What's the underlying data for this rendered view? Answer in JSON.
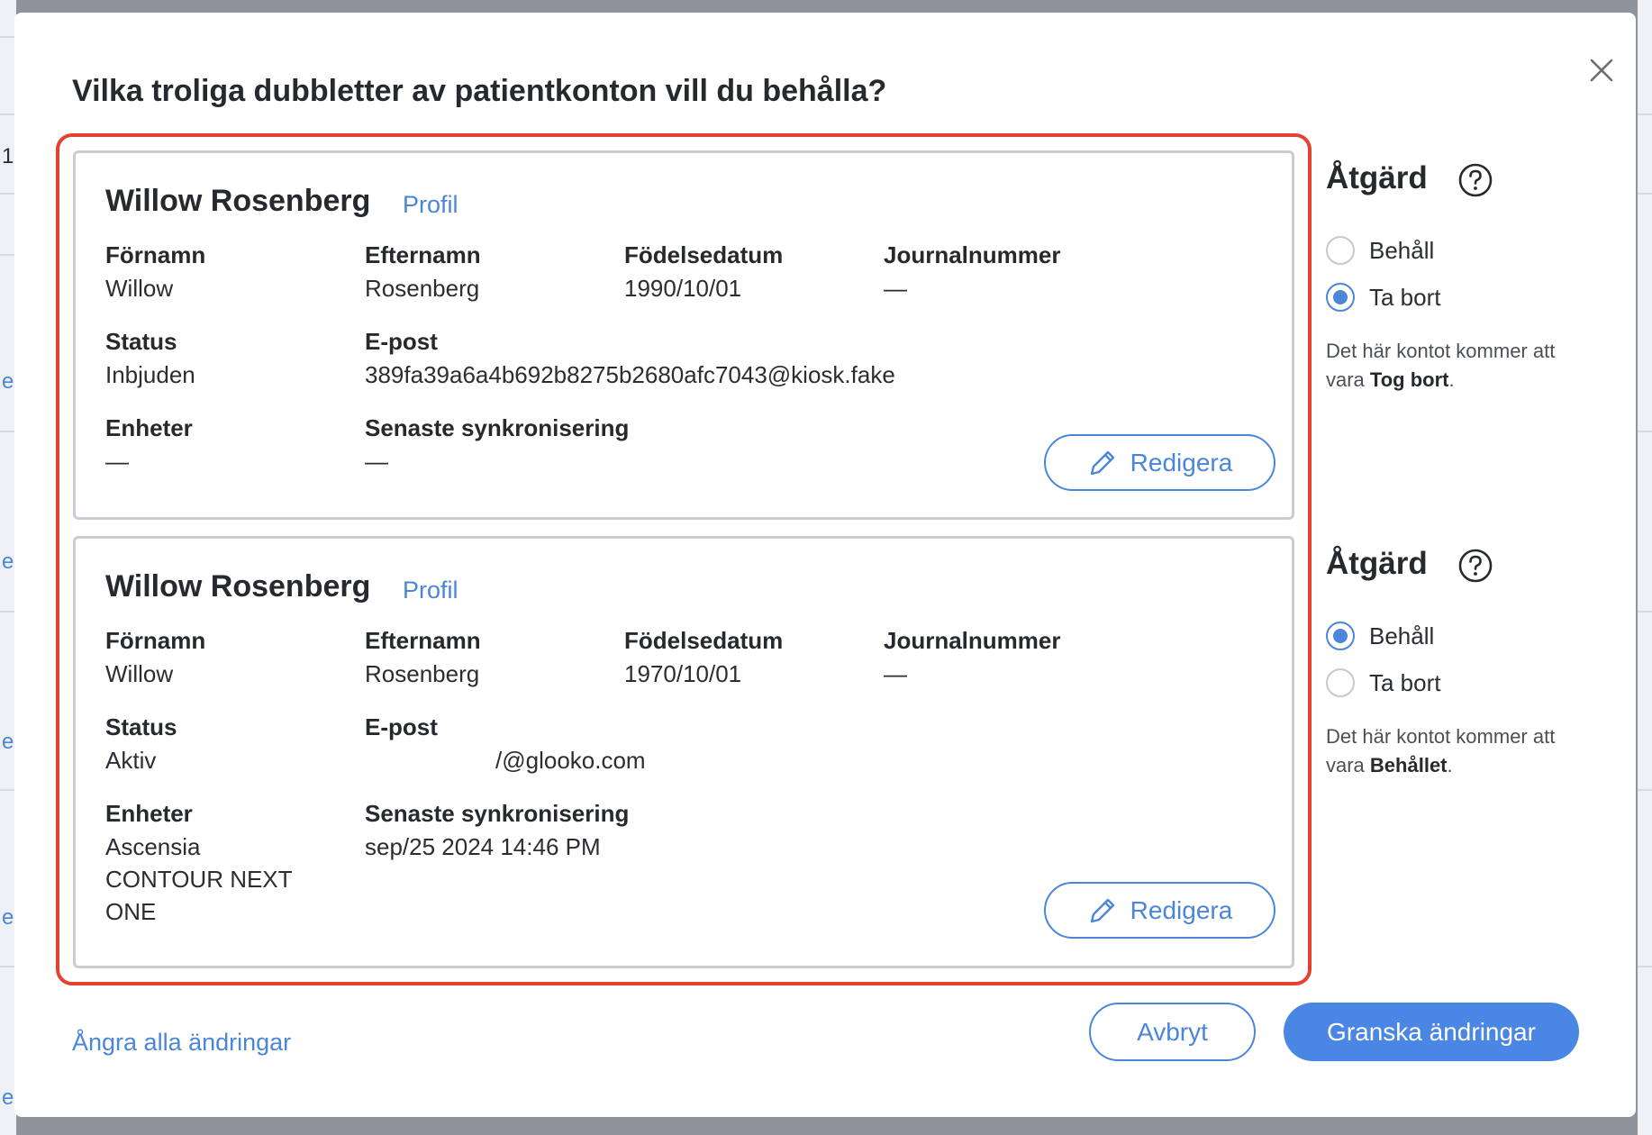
{
  "background": {
    "left_fragments": [
      "1",
      "e",
      "e",
      "e",
      "e",
      "e"
    ]
  },
  "modal": {
    "title": "Vilka troliga dubbletter av patientkonton vill du behålla?",
    "close_icon": "close-icon"
  },
  "accounts": [
    {
      "name": "Willow Rosenberg",
      "profile_link": "Profil",
      "labels": {
        "first_name": "Förnamn",
        "last_name": "Efternamn",
        "birthdate": "Födelsedatum",
        "record_number": "Journalnummer",
        "status": "Status",
        "email": "E-post",
        "devices": "Enheter",
        "last_sync": "Senaste synkronisering"
      },
      "values": {
        "first_name": "Willow",
        "last_name": "Rosenberg",
        "birthdate": "1990/10/01",
        "record_number": "—",
        "status": "Inbjuden",
        "email": "389fa39a6a4b692b8275b2680afc7043@kiosk.fake",
        "devices": "—",
        "last_sync": "—"
      },
      "edit_label": "Redigera"
    },
    {
      "name": "Willow Rosenberg",
      "profile_link": "Profil",
      "labels": {
        "first_name": "Förnamn",
        "last_name": "Efternamn",
        "birthdate": "Födelsedatum",
        "record_number": "Journalnummer",
        "status": "Status",
        "email": "E-post",
        "devices": "Enheter",
        "last_sync": "Senaste synkronisering"
      },
      "values": {
        "first_name": "Willow",
        "last_name": "Rosenberg",
        "birthdate": "1970/10/01",
        "record_number": "—",
        "status": "Aktiv",
        "email": "/@glooko.com",
        "devices": "Ascensia CONTOUR NEXT ONE",
        "last_sync": "sep/25 2024 14:46 PM"
      },
      "edit_label": "Redigera"
    }
  ],
  "actions": [
    {
      "title": "Åtgärd",
      "options": [
        "Behåll",
        "Ta bort"
      ],
      "selected": "Ta bort",
      "note_prefix": "Det här kontot kommer att vara ",
      "note_bold": "Tog bort",
      "note_suffix": "."
    },
    {
      "title": "Åtgärd",
      "options": [
        "Behåll",
        "Ta bort"
      ],
      "selected": "Behåll",
      "note_prefix": "Det här kontot kommer att vara ",
      "note_bold": "Behållet",
      "note_suffix": "."
    }
  ],
  "footer": {
    "undo_all": "Ångra alla ändringar",
    "cancel": "Avbryt",
    "review": "Granska ändringar"
  },
  "colors": {
    "accent": "#4a86d9",
    "highlight": "#e5412f",
    "primary_button": "#4a86e4"
  }
}
